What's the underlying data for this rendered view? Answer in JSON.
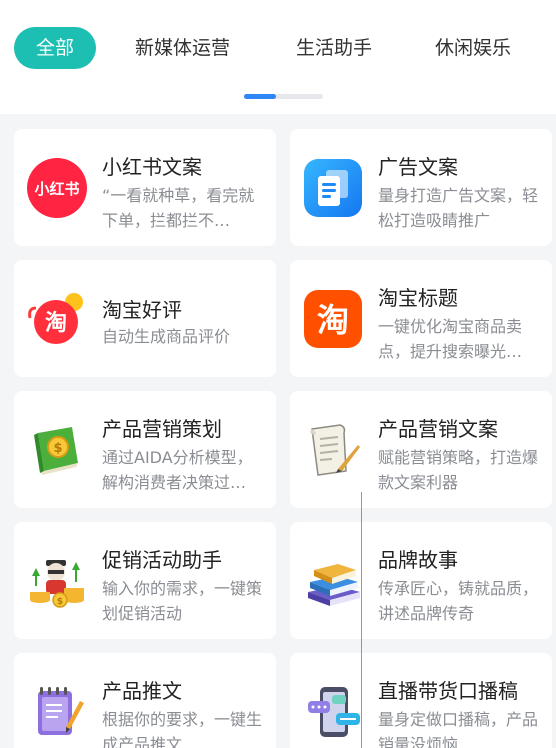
{
  "tabs": [
    {
      "label": "全部"
    },
    {
      "label": "新媒体运营"
    },
    {
      "label": "生活助手"
    },
    {
      "label": "休闲娱乐"
    }
  ],
  "page_indicator": {
    "progress": 0.4
  },
  "cards": [
    {
      "title": "小红书文案",
      "desc": "“一看就种草，看完就下单，拦都拦不…",
      "icon": "xiaohongshu-logo-icon",
      "logo_text": "小红书"
    },
    {
      "title": "广告文案",
      "desc": "量身打造广告文案，轻松打造吸睛推广",
      "icon": "document-copy-icon"
    },
    {
      "title": "淘宝好评",
      "desc": "自动生成商品评价",
      "icon": "taobao-review-icon",
      "logo_text": "淘"
    },
    {
      "title": "淘宝标题",
      "desc": "一键优化淘宝商品卖点，提升搜索曝光…",
      "icon": "taobao-logo-icon",
      "logo_text": "淘"
    },
    {
      "title": "产品营销策划",
      "desc": "通过AIDA分析模型，解构消费者决策过…",
      "icon": "money-book-icon"
    },
    {
      "title": "产品营销文案",
      "desc": "赋能营销策略，打造爆款文案利器",
      "icon": "scroll-quill-icon"
    },
    {
      "title": "促销活动助手",
      "desc": "输入你的需求，一键策划促销活动",
      "icon": "promotion-coins-icon"
    },
    {
      "title": "品牌故事",
      "desc": "传承匠心，铸就品质，讲述品牌传奇",
      "icon": "book-stack-icon"
    },
    {
      "title": "产品推文",
      "desc": "根据你的要求，一键生成产品推文",
      "icon": "notebook-pen-icon"
    },
    {
      "title": "直播带货口播稿",
      "desc": "量身定做口播稿，产品销量没烦恼",
      "icon": "phone-chat-icon"
    }
  ],
  "colors": {
    "accent": "#1dbfb2",
    "indicator": "#2f86f6",
    "xiaohongshu": "#ff2442",
    "taobao": "#ff5000"
  }
}
